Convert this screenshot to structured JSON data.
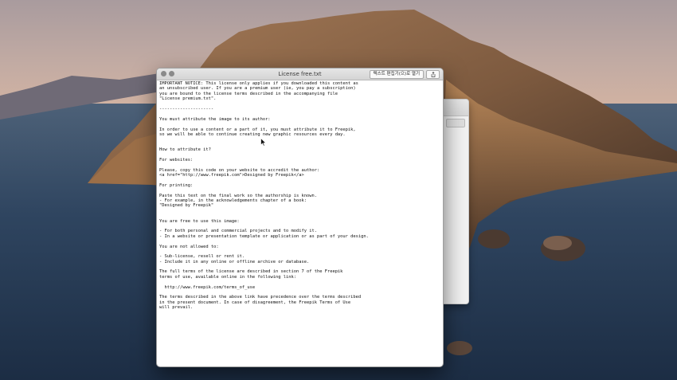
{
  "window": {
    "title": "License free.txt",
    "open_button_label": "텍스트 편집기(으)로 열기",
    "share_icon": "share-icon"
  },
  "content": {
    "lines": [
      "IMPORTANT NOTICE: This license only applies if you downloaded this content as",
      "an unsubscribed user. If you are a premium user (ie, you pay a subscription)",
      "you are bound to the license terms described in the accompanying file",
      "\"License premium.txt\".",
      "",
      "---------------------",
      "",
      "You must attribute the image to its author:",
      "",
      "In order to use a content or a part of it, you must attribute it to Freepik,",
      "so we will be able to continue creating new graphic resources every day.",
      "",
      "",
      "How to attribute it?",
      "",
      "For websites:",
      "",
      "Please, copy this code on your website to accredit the author:",
      "<a href=\"http://www.freepik.com\">Designed by Freepik</a>",
      "",
      "For printing:",
      "",
      "Paste this text on the final work so the authorship is known.",
      "- For example, in the acknowledgements chapter of a book:",
      "\"Designed by Freepik\"",
      "",
      "",
      "You are free to use this image:",
      "",
      "- For both personal and commercial projects and to modify it.",
      "- In a website or presentation template or application or as part of your design.",
      "",
      "You are not allowed to:",
      "",
      "- Sub-license, resell or rent it.",
      "- Include it in any online or offline archive or database.",
      "",
      "The full terms of the license are described in section 7 of the Freepik",
      "terms of use, available online in the following link:",
      "",
      "  http://www.freepik.com/terms_of_use",
      "",
      "The terms described in the above link have precedence over the terms described",
      "in the present document. In case of disagreement, the Freepik Terms of Use",
      "will prevail."
    ]
  }
}
